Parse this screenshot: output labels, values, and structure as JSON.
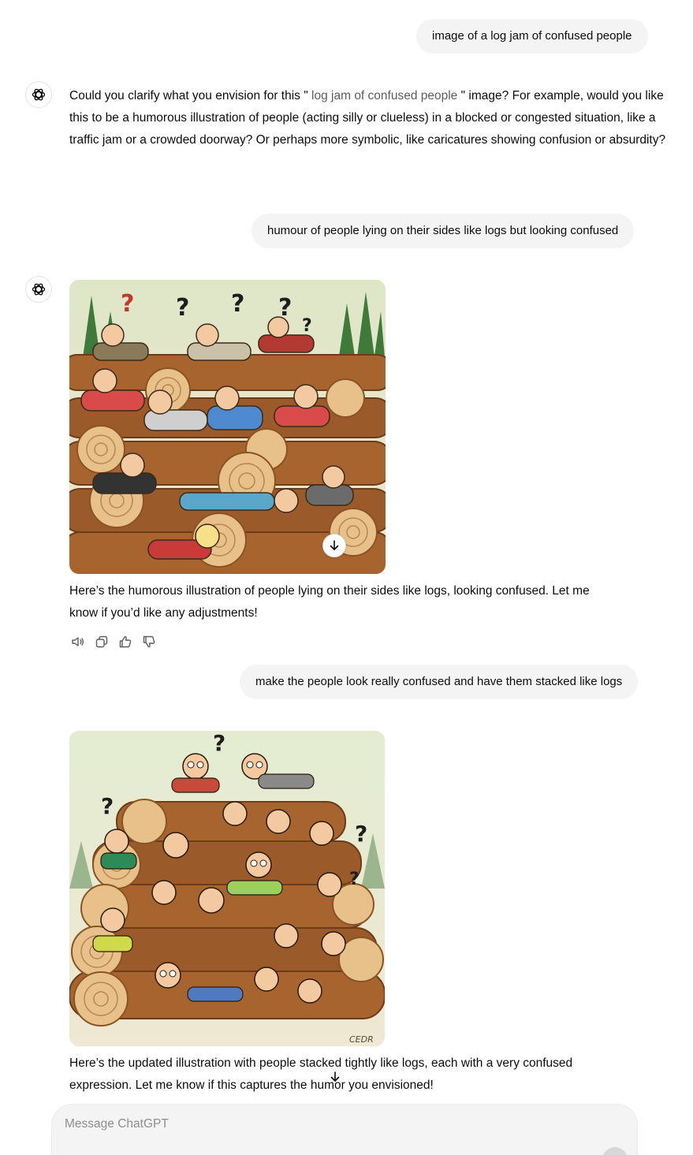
{
  "messages": {
    "user_1": "image of a log jam of confused people",
    "assistant_1": {
      "before": "Could you clarify what you envision for this \"",
      "quoted": " log jam of confused people ",
      "after": "\" image? For example, would you like this to be a humorous illustration of people (acting silly or clueless) in a blocked or congested situation, like a traffic jam or a crowded doorway? Or perhaps more symbolic, like caricatures showing confusion or absurdity?"
    },
    "user_2": "humour of people lying on their sides like logs but looking confused",
    "assistant_2": {
      "image_alt": "Cartoon of confused people lying on their sides on top of logs in a forest clearing",
      "text": "Here’s the humorous illustration of people lying on their sides like logs, looking confused. Let me know if you’d like any adjustments!"
    },
    "user_3": "make the people look really confused and have them stacked like logs",
    "assistant_3": {
      "image_alt": "Cartoon of very confused people stacked tightly between logs with question marks above them",
      "image_signature": "CEDR",
      "text": "Here’s the updated illustration with people stacked tightly like logs, each with a very confused expression. Let me know if this captures the humor you envisioned!"
    }
  },
  "icons": {
    "assistant_avatar": "openai-logo-icon",
    "download": "arrow-down-icon",
    "read_aloud": "speaker-icon",
    "copy": "copy-icon",
    "thumbs_up": "thumbs-up-icon",
    "thumbs_down": "thumbs-down-icon",
    "scroll_down": "arrow-down-icon"
  },
  "composer": {
    "placeholder": "Message ChatGPT"
  },
  "colors": {
    "user_bubble": "#f4f4f4",
    "text": "#0d0d0d",
    "muted": "#8e8e8e"
  }
}
